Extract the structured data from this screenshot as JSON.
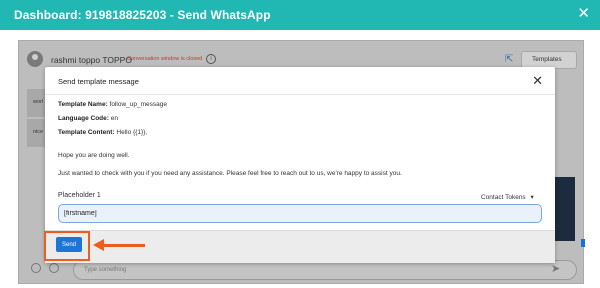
{
  "window": {
    "title": "Dashboard: 919818825203 - Send WhatsApp",
    "close_glyph": "✕"
  },
  "chat": {
    "contact_name": "rashmi toppo TOPPO",
    "conversation_status": "Conversation window is closed",
    "info_glyph": "i",
    "external_link_glyph": "⇱",
    "templates_label": "Templates",
    "templates_chevron": "⌄",
    "list_items": [
      "worl",
      "nice"
    ],
    "message_placeholder": "Type something",
    "send_glyph": "➤"
  },
  "modal": {
    "title": "Send template message",
    "close_glyph": "✕",
    "template_name_label": "Template Name:",
    "template_name_value": "follow_up_message",
    "language_code_label": "Language Code:",
    "language_code_value": "en",
    "template_content_label": "Template Content:",
    "template_content_value": "Hello {{1}},",
    "body_line_1": "Hope you are doing well.",
    "body_line_2": "Just wanted to check with you if you need any assistance. Please feel free to reach out to us, we're happy to assist you.",
    "placeholder_label": "Placeholder 1",
    "contact_tokens_label": "Contact Tokens",
    "contact_tokens_caret": "▾",
    "placeholder_value": "[firstname]",
    "send_label": "Send"
  },
  "annotation": {
    "highlight_color": "#ee5c1e"
  },
  "colors": {
    "topbar": "#21b7b2",
    "primary_button": "#1c76d8",
    "status_closed": "#c0392b"
  }
}
